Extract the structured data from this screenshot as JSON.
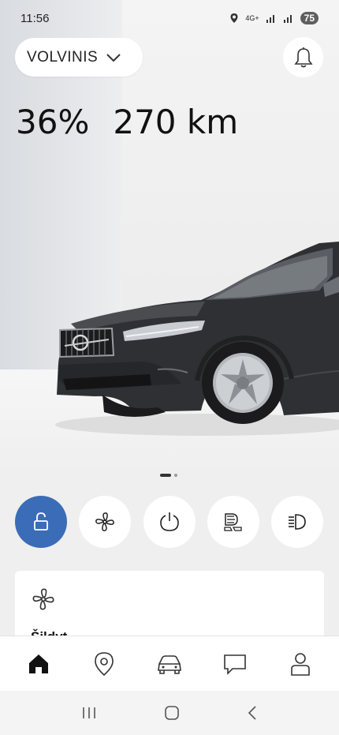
{
  "status_bar": {
    "time": "11:56",
    "network": "4G+",
    "battery": "75"
  },
  "header": {
    "car_name": "VOLVINIS",
    "car_dropdown_icon": "chevron-down-icon",
    "notifications_icon": "bell-icon"
  },
  "vehicle": {
    "battery_percent": "36%",
    "range": "270 km",
    "carousel_position": 1,
    "carousel_count": 2
  },
  "quick_actions": [
    {
      "name": "unlock",
      "icon": "unlocked-padlock-icon",
      "active": true
    },
    {
      "name": "climate",
      "icon": "fan-icon"
    },
    {
      "name": "engine",
      "icon": "power-icon"
    },
    {
      "name": "high-beam",
      "icon": "high-beam-icon"
    },
    {
      "name": "lights",
      "icon": "headlight-icon"
    }
  ],
  "climate_card": {
    "icon": "fan-icon",
    "title": "Šildyt..."
  },
  "bottom_nav": [
    {
      "name": "home",
      "icon": "home-icon",
      "active": true
    },
    {
      "name": "map",
      "icon": "location-pin-icon"
    },
    {
      "name": "car",
      "icon": "car-icon"
    },
    {
      "name": "messages",
      "icon": "chat-icon"
    },
    {
      "name": "profile",
      "icon": "person-icon"
    }
  ],
  "colors": {
    "accent": "#3b6cb7",
    "background": "#efefef",
    "card": "#ffffff"
  }
}
